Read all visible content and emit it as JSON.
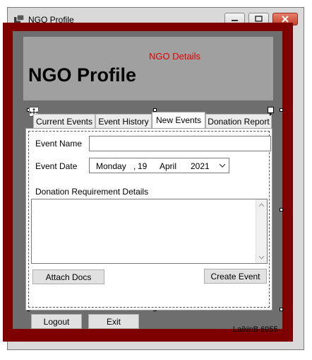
{
  "window": {
    "title": "NGO Profile"
  },
  "header": {
    "details_label": "NGO Details",
    "title": "NGO Profile"
  },
  "tabs": [
    {
      "label": "Current Events",
      "active": false
    },
    {
      "label": "Event History",
      "active": false
    },
    {
      "label": "New Events",
      "active": true
    },
    {
      "label": "Donation Report",
      "active": false
    }
  ],
  "form": {
    "event_name_label": "Event Name",
    "event_name_value": "",
    "event_date_label": "Event Date",
    "date": {
      "weekday": "Monday",
      "sep": ",",
      "day": "19",
      "month": "April",
      "year": "2021"
    },
    "donation_label": "Donation Requirement Details",
    "donation_value": "",
    "attach_button": "Attach Docs",
    "create_button": "Create Event"
  },
  "footer": {
    "logout_button": "Logout",
    "exit_button": "Exit",
    "status_text": "LaikinB 6955"
  },
  "colors": {
    "frame": "#7f0000",
    "panel": "#6e6e6e",
    "header": "#a0a0a0",
    "details_text": "#e00000"
  }
}
